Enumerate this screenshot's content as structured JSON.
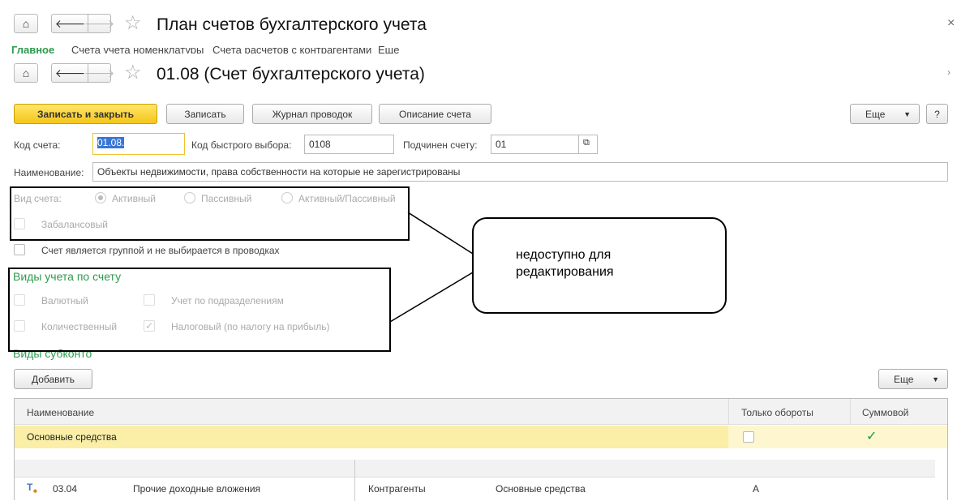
{
  "window1": {
    "title": "План счетов бухгалтерского учета",
    "tabs": [
      "Главное",
      "Счета учета номенклатуры",
      "Счета расчетов с контрагентами",
      "Еще"
    ]
  },
  "window2": {
    "title": "01.08 (Счет бухгалтерского учета)"
  },
  "toolbar": {
    "save_close": "Записать и закрыть",
    "save": "Записать",
    "journal": "Журнал проводок",
    "description": "Описание счета",
    "more": "Еще",
    "help": "?"
  },
  "form": {
    "code_label": "Код счета:",
    "code_value": "01.08.",
    "quick_label": "Код быстрого выбора:",
    "quick_value": "0108",
    "parent_label": "Подчинен счету:",
    "parent_value": "01",
    "name_label": "Наименование:",
    "name_value": "Объекты недвижимости, права собственности на которые не зарегистрированы",
    "type_label": "Вид счета:",
    "type_options": [
      "Активный",
      "Пассивный",
      "Активный/Пассивный"
    ],
    "offbalance": "Забалансовый",
    "is_group": "Счет является группой и не выбирается в проводках"
  },
  "accounting": {
    "title": "Виды учета по счету",
    "currency": "Валютный",
    "subdivisions": "Учет по подразделениям",
    "quantity": "Количественный",
    "tax": "Налоговый (по налогу на прибыль)"
  },
  "subconto": {
    "title": "Виды субконто",
    "add": "Добавить",
    "more": "Еще",
    "columns": [
      "Наименование",
      "Только обороты",
      "Суммовой"
    ],
    "rows": [
      {
        "name": "Основные средства",
        "turnover_only": false,
        "sum": true
      }
    ]
  },
  "background_row": {
    "code": "03.04",
    "name": "Прочие доходные вложения",
    "subconto1": "Контрагенты",
    "subconto2": "Основные средства",
    "type": "А"
  },
  "callout": {
    "text": "недоступно для редактирования"
  }
}
